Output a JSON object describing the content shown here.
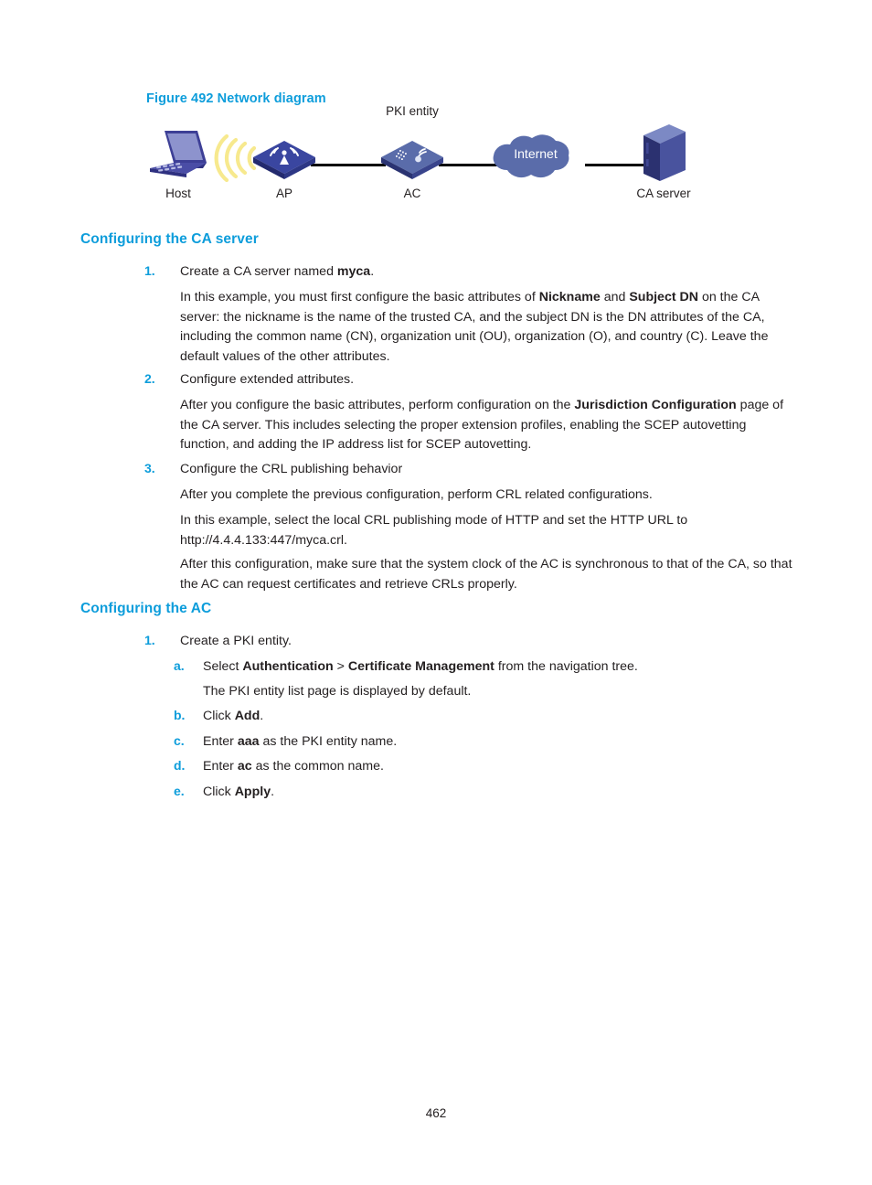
{
  "figure": {
    "caption": "Figure 492 Network diagram",
    "nodes": {
      "host": "Host",
      "ap": "AP",
      "ac": "AC",
      "ac_top": "PKI entity",
      "internet": "Internet",
      "ca_server": "CA server"
    },
    "colors": {
      "caption_blue": "#0d9ddb",
      "device_dark_blue": "#2e3b8f",
      "device_slate": "#5a6caa",
      "cloud_blue": "#5a6caa",
      "wave_yellow": "#f7e98e",
      "link_black": "#000000"
    }
  },
  "sections": [
    {
      "heading": "Configuring the CA server",
      "steps": [
        {
          "marker": "1.",
          "text_html": "Create a CA server named <b>myca</b>.",
          "paragraphs": [
            "In this example, you must first configure the basic attributes of <b>Nickname</b> and <b>Subject DN</b> on the CA server: the nickname is the name of the trusted CA, and the subject DN is the DN attributes of the CA, including the common name (CN), organization unit (OU), organization (O), and country (C). Leave the default values of the other attributes."
          ]
        },
        {
          "marker": "2.",
          "text_html": "Configure extended attributes.",
          "paragraphs": [
            "After you configure the basic attributes, perform configuration on the <b>Jurisdiction Configuration</b> page of the CA server. This includes selecting the proper extension profiles, enabling the SCEP autovetting function, and adding the IP address list for SCEP autovetting."
          ]
        },
        {
          "marker": "3.",
          "text_html": "Configure the CRL publishing behavior",
          "paragraphs": [
            "After you complete the previous configuration, perform CRL related configurations.",
            "In this example, select the local CRL publishing mode of HTTP and set the HTTP URL to http://4.4.4.133:447/myca.crl.",
            "After this configuration, make sure that the system clock of the AC is synchronous to that of the CA, so that the AC can request certificates and retrieve CRLs properly."
          ]
        }
      ]
    },
    {
      "heading": "Configuring the AC",
      "steps": [
        {
          "marker": "1.",
          "text_html": "Create a PKI entity.",
          "substeps": [
            {
              "marker": "a.",
              "text_html": "Select <b>Authentication</b> &gt; <b>Certificate Management</b> from the navigation tree.",
              "note": "The PKI entity list page is displayed by default."
            },
            {
              "marker": "b.",
              "text_html": "Click <b>Add</b>."
            },
            {
              "marker": "c.",
              "text_html": "Enter <b>aaa</b> as the PKI entity name."
            },
            {
              "marker": "d.",
              "text_html": "Enter <b>ac</b> as the common name."
            },
            {
              "marker": "e.",
              "text_html": "Click <b>Apply</b>."
            }
          ]
        }
      ]
    }
  ],
  "footer": {
    "page_number": "462"
  }
}
